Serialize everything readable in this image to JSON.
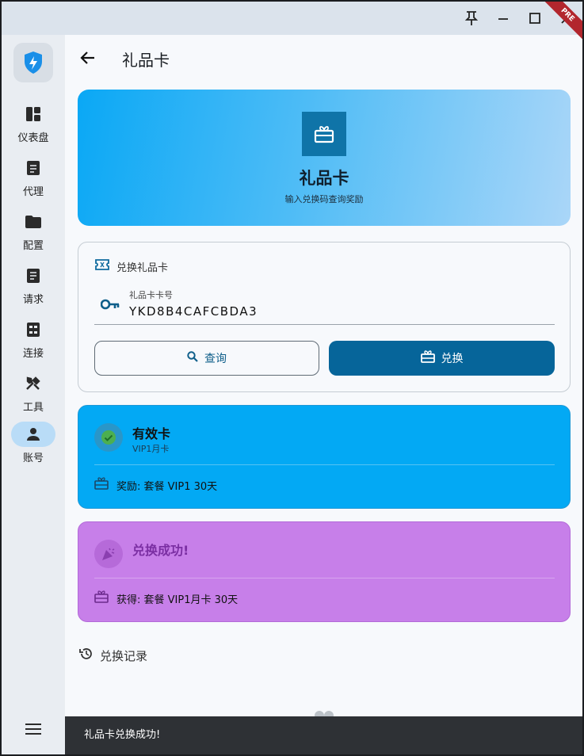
{
  "titlebar": {
    "pin_icon": "pin-icon",
    "minimize_icon": "minimize-icon",
    "maximize_icon": "maximize-icon",
    "close_icon": "close-icon",
    "ribbon": "PRE"
  },
  "sidebar": {
    "items": [
      {
        "label": "仪表盘",
        "icon": "dashboard-icon"
      },
      {
        "label": "代理",
        "icon": "article-icon"
      },
      {
        "label": "配置",
        "icon": "folder-icon"
      },
      {
        "label": "请求",
        "icon": "request-icon"
      },
      {
        "label": "连接",
        "icon": "connection-icon"
      },
      {
        "label": "工具",
        "icon": "tools-icon"
      },
      {
        "label": "账号",
        "icon": "person-icon",
        "active": true
      }
    ]
  },
  "header": {
    "title": "礼品卡"
  },
  "hero": {
    "title": "礼品卡",
    "subtitle": "输入兑换码查询奖励"
  },
  "redeem": {
    "heading": "兑换礼品卡",
    "field_label": "礼品卡卡号",
    "field_value": "YKD8B4CAFCBDA3",
    "query_label": "查询",
    "redeem_label": "兑换"
  },
  "valid_card": {
    "title": "有效卡",
    "subtitle": "VIP1月卡",
    "reward": "奖励: 套餐 VIP1 30天"
  },
  "success_card": {
    "title": "兑换成功!",
    "reward": "获得: 套餐 VIP1月卡 30天"
  },
  "history": {
    "label": "兑换记录"
  },
  "snackbar": {
    "message": "礼品卡兑换成功!"
  },
  "colors": {
    "primary": "#06659a",
    "valid_bg": "#03a9f4",
    "success_bg": "#c77fe9",
    "snackbar_bg": "#2e3135"
  }
}
